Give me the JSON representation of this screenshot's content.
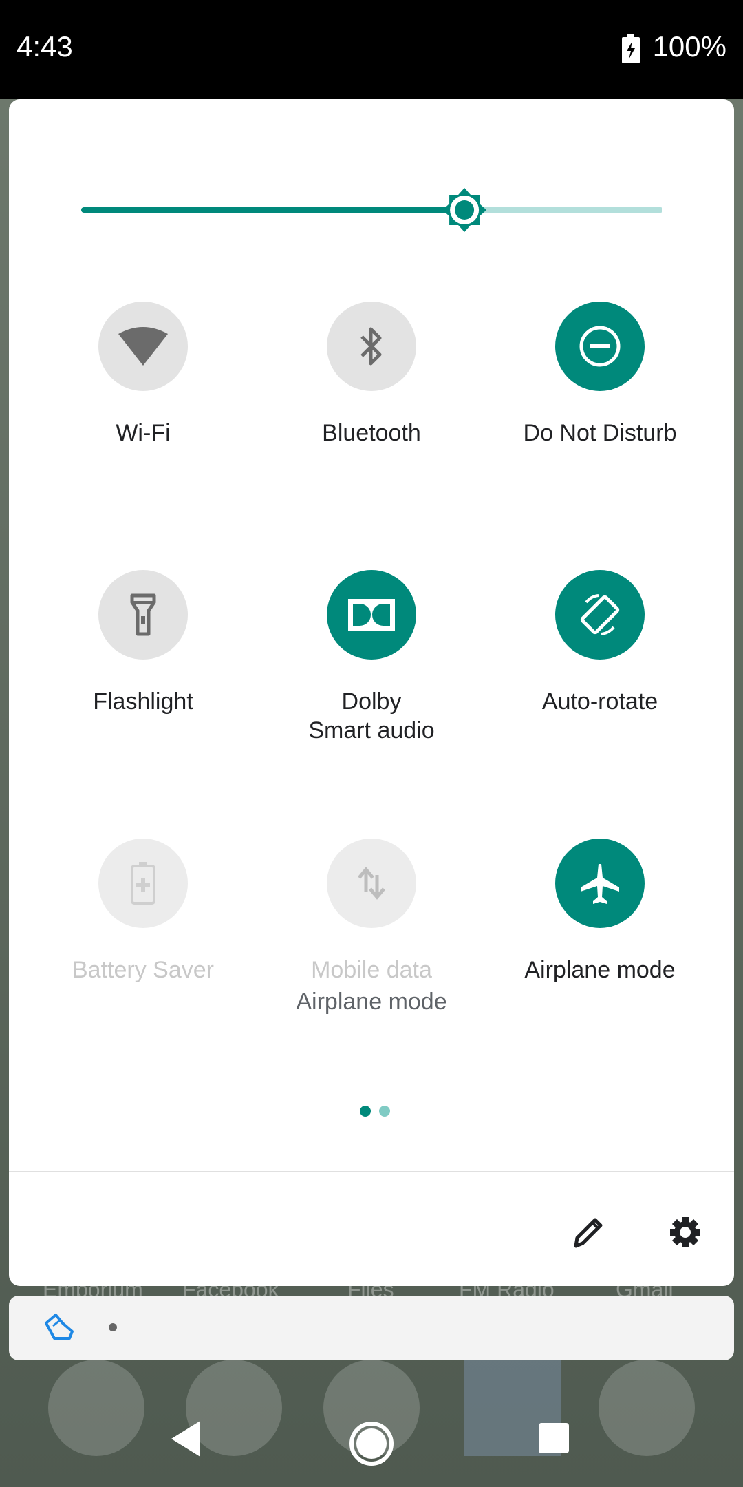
{
  "status_bar": {
    "time": "4:43",
    "battery_percent": "100%"
  },
  "brightness": {
    "level": 0.66
  },
  "tiles": [
    {
      "label": "Wi-Fi",
      "state": "off",
      "icon": "wifi-icon"
    },
    {
      "label": "Bluetooth",
      "state": "off",
      "icon": "bluetooth-icon"
    },
    {
      "label": "Do Not Disturb",
      "state": "on",
      "icon": "do-not-disturb-icon"
    },
    {
      "label": "Flashlight",
      "state": "off",
      "icon": "flashlight-icon"
    },
    {
      "label": "Dolby",
      "sublabel": "Smart audio",
      "state": "on",
      "icon": "dolby-icon"
    },
    {
      "label": "Auto-rotate",
      "state": "on",
      "icon": "auto-rotate-icon"
    },
    {
      "label": "Battery Saver",
      "state": "disabled",
      "icon": "battery-saver-icon"
    },
    {
      "label": "Mobile data",
      "sublabel": "Airplane mode",
      "state": "disabled",
      "icon": "mobile-data-icon"
    },
    {
      "label": "Airplane mode",
      "state": "on",
      "icon": "airplane-icon"
    }
  ],
  "page_indicator": {
    "current": 1,
    "total": 2
  },
  "background_apps": [
    "Emporium",
    "Facebook",
    "Files",
    "FM Radio",
    "Gmail"
  ],
  "colors": {
    "accent": "#00897b",
    "accent_light": "#b2dfdb",
    "tile_off": "#e3e3e3"
  }
}
